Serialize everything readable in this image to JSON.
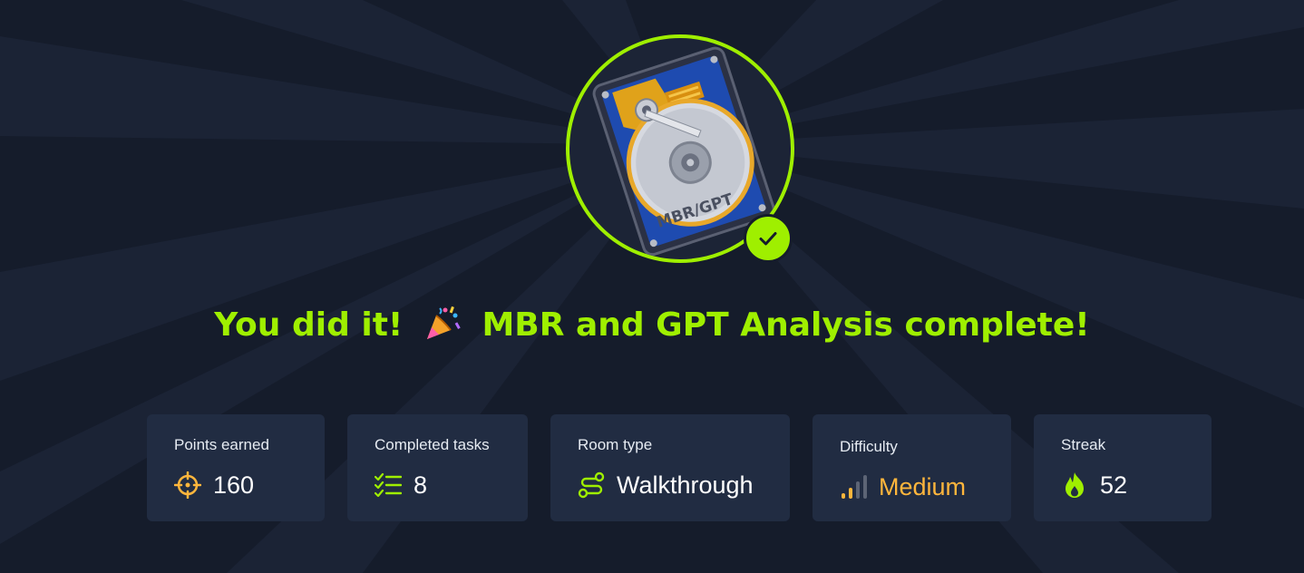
{
  "badge": {
    "disk_label": "MBR/GPT",
    "status": "completed",
    "accent_color": "#9fef00"
  },
  "headline": {
    "prefix": "You did it!",
    "emoji_icon": "party-popper-icon",
    "suffix": "MBR and GPT Analysis complete!"
  },
  "stats": {
    "points": {
      "label": "Points earned",
      "value": "160",
      "icon": "crosshair-icon"
    },
    "tasks": {
      "label": "Completed tasks",
      "value": "8",
      "icon": "checklist-icon"
    },
    "room_type": {
      "label": "Room type",
      "value": "Walkthrough",
      "icon": "route-icon"
    },
    "difficulty": {
      "label": "Difficulty",
      "value": "Medium",
      "icon": "signal-bars-icon",
      "color": "#ffb63c"
    },
    "streak": {
      "label": "Streak",
      "value": "52",
      "icon": "flame-icon"
    }
  }
}
